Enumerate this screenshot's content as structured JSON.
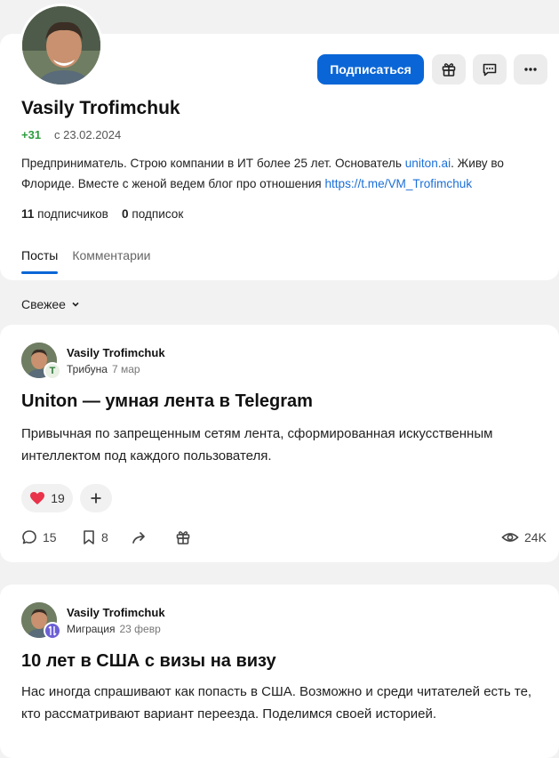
{
  "profile": {
    "name": "Vasily Trofimchuk",
    "karma": "+31",
    "since": "с 23.02.2024",
    "bio_part1": "Предприниматель. Строю компании в ИТ более 25 лет. Основатель ",
    "bio_link1": "uniton.ai",
    "bio_part2": ". Живу во Флориде. Вместе с женой ведем блог про отношения ",
    "bio_link2": "https://t.me/VM_Trofimchuk",
    "followers_count": "11",
    "followers_label": "подписчиков",
    "following_count": "0",
    "following_label": "подписок",
    "subscribe_label": "Подписаться"
  },
  "tabs": [
    {
      "label": "Посты",
      "active": true
    },
    {
      "label": "Комментарии",
      "active": false
    }
  ],
  "sort": {
    "label": "Свежее"
  },
  "posts": [
    {
      "author": "Vasily Trofimchuk",
      "community": "Трибуна",
      "date": "7 мар",
      "title": "Uniton — умная лента в Telegram",
      "text": "Привычная по запрещенным сетям лента, сформированная искусственным интеллектом под каждого пользователя.",
      "likes": "19",
      "comments": "15",
      "bookmarks": "8",
      "views": "24K",
      "badge_letter": "Т"
    },
    {
      "author": "Vasily Trofimchuk",
      "community": "Миграция",
      "date": "23 февр",
      "title": "10 лет в США с визы на визу",
      "text": "Нас иногда спрашивают как попасть в США. Возможно и среди читателей есть те, кто рассматривают вариант переезда. Поделимся своей историей."
    }
  ],
  "colors": {
    "accent": "#0a66d6",
    "karma": "#2d9c3c",
    "heart": "#e8334a"
  }
}
